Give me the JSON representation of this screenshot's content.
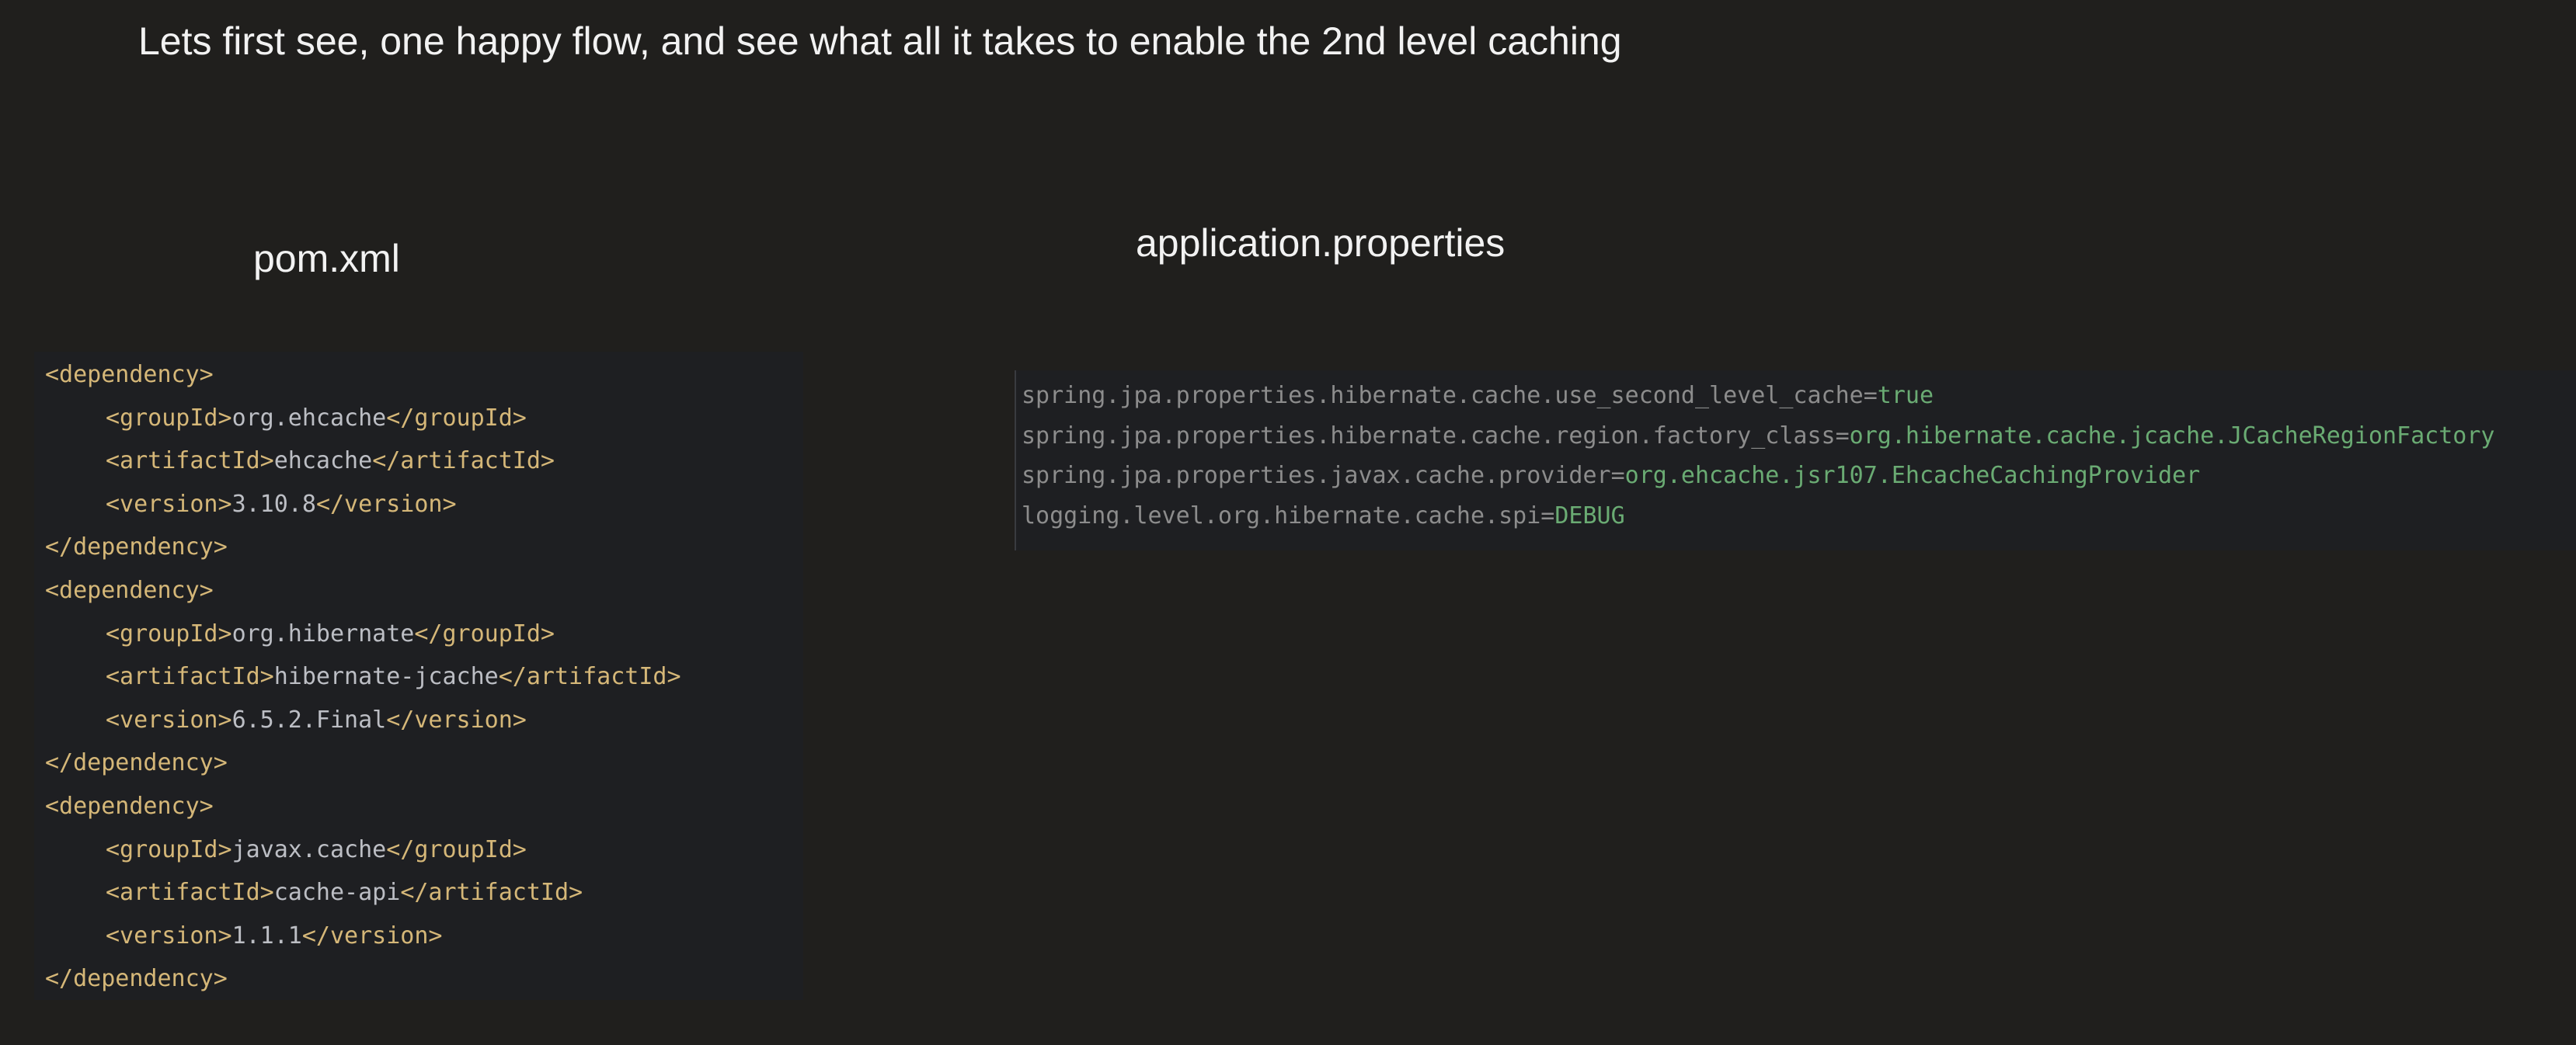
{
  "slide": {
    "title": "Lets first see, one happy flow, and see what all it takes to enable the 2nd level caching"
  },
  "pom": {
    "heading": "pom.xml",
    "lines": [
      {
        "indent": 0,
        "open": "<dependency>",
        "content": "",
        "close": ""
      },
      {
        "indent": 1,
        "open": "<groupId>",
        "content": "org.ehcache",
        "close": "</groupId>"
      },
      {
        "indent": 1,
        "open": "<artifactId>",
        "content": "ehcache",
        "close": "</artifactId>"
      },
      {
        "indent": 1,
        "open": "<version>",
        "content": "3.10.8",
        "close": "</version>"
      },
      {
        "indent": 0,
        "open": "</dependency>",
        "content": "",
        "close": ""
      },
      {
        "indent": 0,
        "open": "<dependency>",
        "content": "",
        "close": ""
      },
      {
        "indent": 1,
        "open": "<groupId>",
        "content": "org.hibernate",
        "close": "</groupId>"
      },
      {
        "indent": 1,
        "open": "<artifactId>",
        "content": "hibernate-jcache",
        "close": "</artifactId>"
      },
      {
        "indent": 1,
        "open": "<version>",
        "content": "6.5.2.Final",
        "close": "</version>"
      },
      {
        "indent": 0,
        "open": "</dependency>",
        "content": "",
        "close": ""
      },
      {
        "indent": 0,
        "open": "<dependency>",
        "content": "",
        "close": ""
      },
      {
        "indent": 1,
        "open": "<groupId>",
        "content": "javax.cache",
        "close": "</groupId>"
      },
      {
        "indent": 1,
        "open": "<artifactId>",
        "content": "cache-api",
        "close": "</artifactId>"
      },
      {
        "indent": 1,
        "open": "<version>",
        "content": "1.1.1",
        "close": "</version>"
      },
      {
        "indent": 0,
        "open": "</dependency>",
        "content": "",
        "close": ""
      }
    ]
  },
  "properties": {
    "heading": "application.properties",
    "lines": [
      {
        "key": "spring.jpa.properties.hibernate.cache.use_second_level_cache",
        "value": "true"
      },
      {
        "key": "spring.jpa.properties.hibernate.cache.region.factory_class",
        "value": "org.hibernate.cache.jcache.JCacheRegionFactory"
      },
      {
        "key": "spring.jpa.properties.javax.cache.provider",
        "value": "org.ehcache.jsr107.EhcacheCachingProvider"
      },
      {
        "key": "logging.level.org.hibernate.cache.spi",
        "value": "DEBUG"
      }
    ]
  },
  "colors": {
    "background": "#201f1d",
    "code_background": "#1e1f22",
    "xml_tag": "#d5b778",
    "xml_text": "#bcbec4",
    "property_key": "#8c8c8c",
    "property_value": "#6aab73"
  }
}
